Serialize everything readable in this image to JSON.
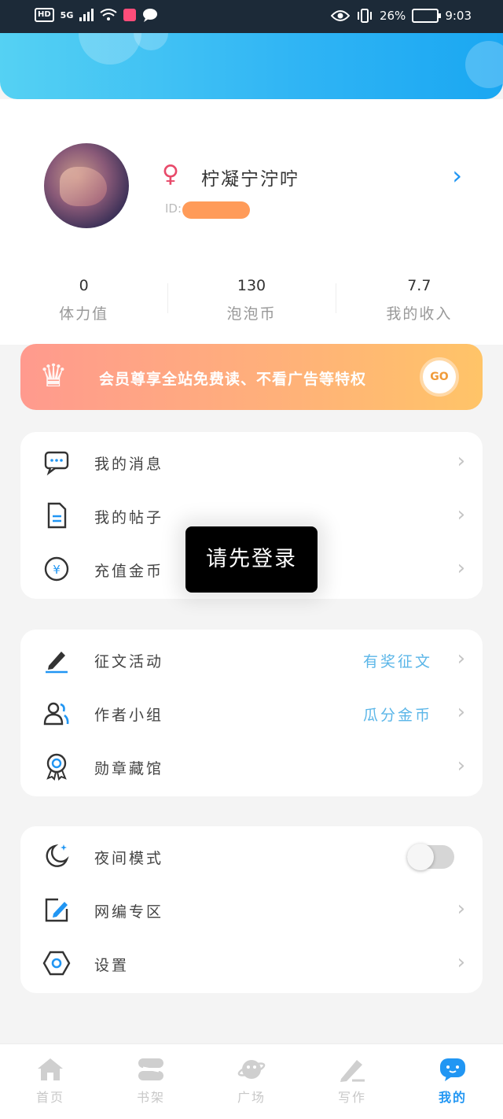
{
  "status_bar": {
    "network": "5G",
    "battery_percent": "26%",
    "time": "9:03"
  },
  "profile": {
    "username": "柠凝宁泞咛",
    "id_label": "ID:",
    "stats": [
      {
        "value": "0",
        "label": "体力值"
      },
      {
        "value": "130",
        "label": "泡泡币"
      },
      {
        "value": "7.7",
        "label": "我的收入"
      }
    ]
  },
  "vip_banner": {
    "text": "会员尊享全站免费读、不看广告等特权",
    "button": "GO"
  },
  "menu_groups": [
    {
      "items": [
        {
          "label": "我的消息",
          "icon": "message-icon"
        },
        {
          "label": "我的帖子",
          "icon": "document-icon"
        },
        {
          "label": "充值金币",
          "icon": "coin-icon"
        }
      ]
    },
    {
      "items": [
        {
          "label": "征文活动",
          "extra": "有奖征文",
          "icon": "pen-icon"
        },
        {
          "label": "作者小组",
          "extra": "瓜分金币",
          "icon": "group-icon"
        },
        {
          "label": "勋章藏馆",
          "icon": "medal-icon"
        }
      ]
    },
    {
      "items": [
        {
          "label": "夜间模式",
          "icon": "moon-icon",
          "toggle_on": false
        },
        {
          "label": "网编专区",
          "icon": "edit-icon"
        },
        {
          "label": "设置",
          "icon": "settings-icon"
        }
      ]
    }
  ],
  "toast": "请先登录",
  "bottom_nav": [
    {
      "label": "首页",
      "icon": "home-icon"
    },
    {
      "label": "书架",
      "icon": "bookshelf-icon"
    },
    {
      "label": "广场",
      "icon": "planet-icon"
    },
    {
      "label": "写作",
      "icon": "write-icon"
    },
    {
      "label": "我的",
      "icon": "profile-icon",
      "active": true
    }
  ],
  "colors": {
    "accent": "#2196f3",
    "header_start": "#55d1f3",
    "header_end": "#1aa7f2",
    "vip_start": "#ff9a8e",
    "vip_end": "#ffc468",
    "highlight_text": "#5bb6e8"
  }
}
